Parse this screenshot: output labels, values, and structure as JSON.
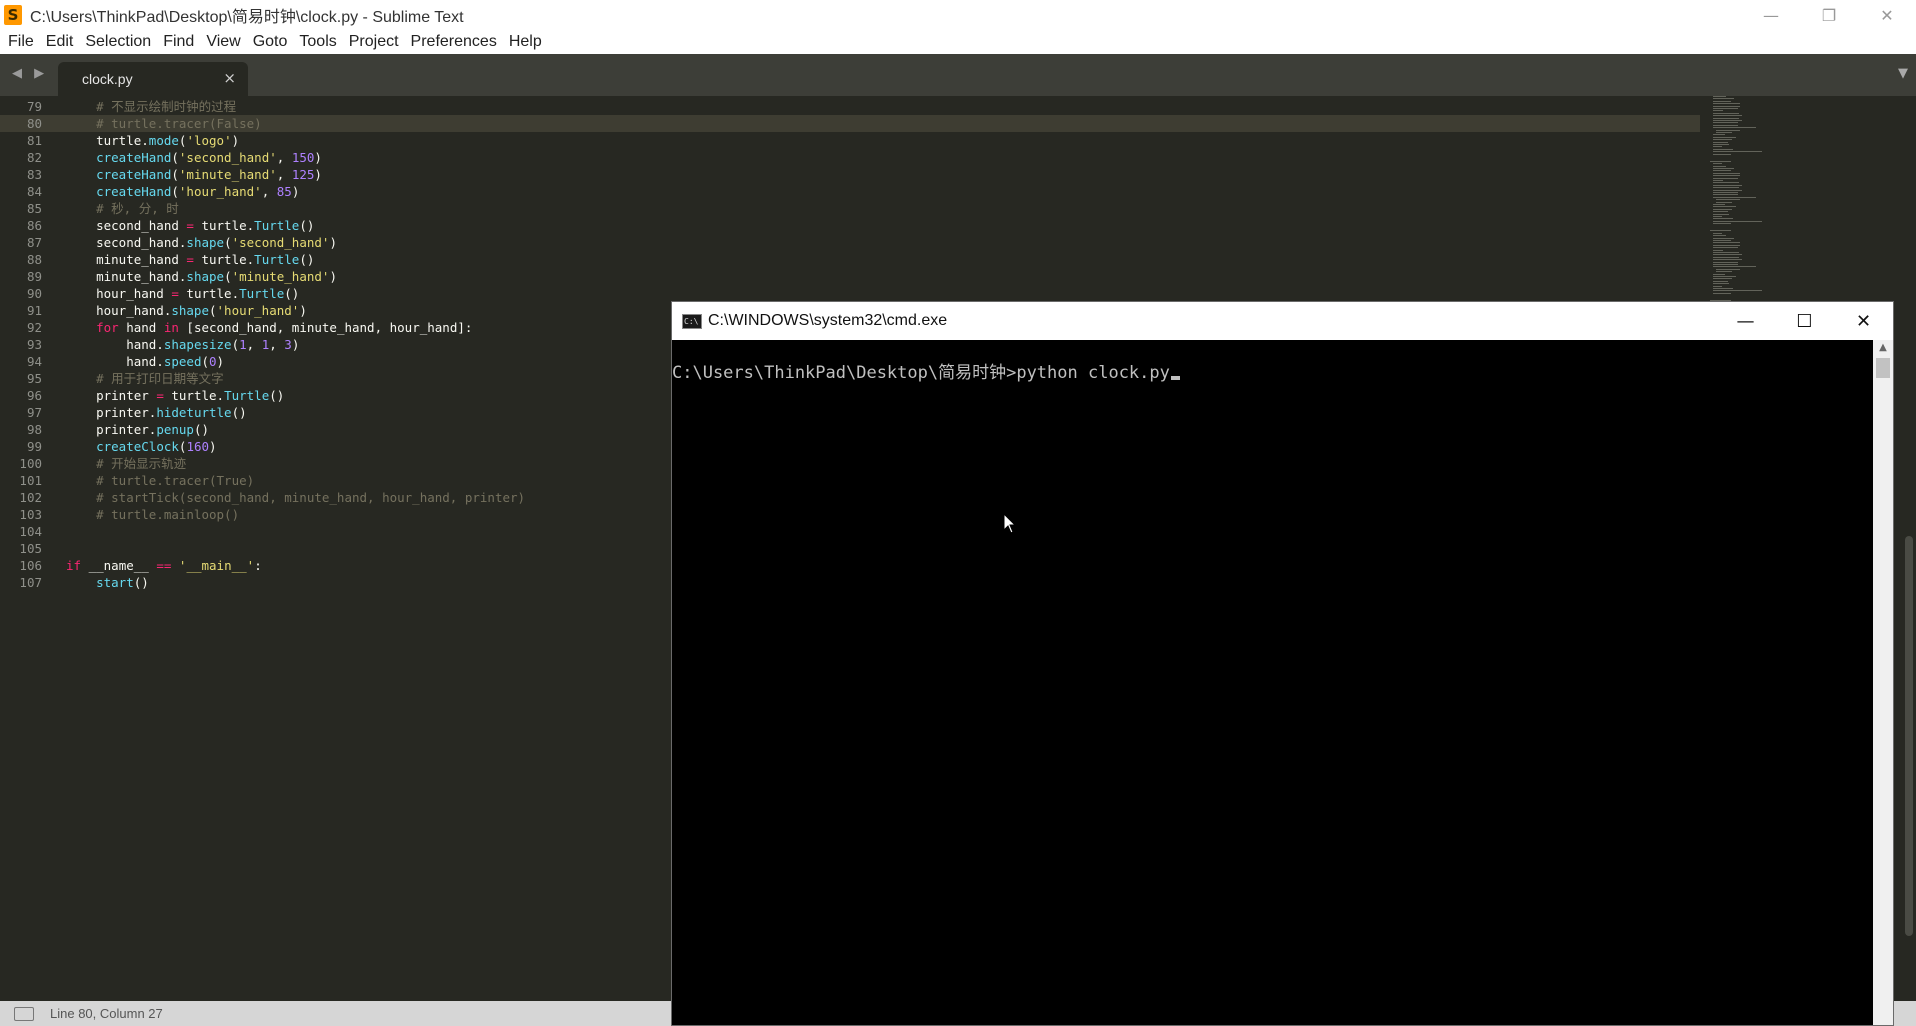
{
  "sublime": {
    "title": "C:\\Users\\ThinkPad\\Desktop\\简易时钟\\clock.py - Sublime Text",
    "app_icon_glyph": "S",
    "controls": {
      "minimize": "—",
      "restore": "❐",
      "close": "✕"
    },
    "menu": [
      "File",
      "Edit",
      "Selection",
      "Find",
      "View",
      "Goto",
      "Tools",
      "Project",
      "Preferences",
      "Help"
    ],
    "nav_arrows": "◀ ▶",
    "tab": {
      "label": "clock.py",
      "close": "×"
    },
    "tab_dropdown": "▼",
    "status": "Line 80, Column 27"
  },
  "editor": {
    "current_line": 80,
    "lines": [
      {
        "n": "79",
        "tokens": [
          [
            "cm",
            "    # 不显示绘制时钟的过程"
          ]
        ]
      },
      {
        "n": "80",
        "tokens": [
          [
            "cm",
            "    # turtle.tracer(False)"
          ]
        ]
      },
      {
        "n": "81",
        "tokens": [
          [
            "",
            "    turtle."
          ],
          [
            "fn",
            "mode"
          ],
          [
            "",
            "("
          ],
          [
            "st",
            "'logo'"
          ],
          [
            "",
            ")"
          ]
        ]
      },
      {
        "n": "82",
        "tokens": [
          [
            "",
            "    "
          ],
          [
            "fn",
            "createHand"
          ],
          [
            "",
            "("
          ],
          [
            "st",
            "'second_hand'"
          ],
          [
            "",
            ", "
          ],
          [
            "nu",
            "150"
          ],
          [
            "",
            ")"
          ]
        ]
      },
      {
        "n": "83",
        "tokens": [
          [
            "",
            "    "
          ],
          [
            "fn",
            "createHand"
          ],
          [
            "",
            "("
          ],
          [
            "st",
            "'minute_hand'"
          ],
          [
            "",
            ", "
          ],
          [
            "nu",
            "125"
          ],
          [
            "",
            ")"
          ]
        ]
      },
      {
        "n": "84",
        "tokens": [
          [
            "",
            "    "
          ],
          [
            "fn",
            "createHand"
          ],
          [
            "",
            "("
          ],
          [
            "st",
            "'hour_hand'"
          ],
          [
            "",
            ", "
          ],
          [
            "nu",
            "85"
          ],
          [
            "",
            ")"
          ]
        ]
      },
      {
        "n": "85",
        "tokens": [
          [
            "cm",
            "    # 秒, 分, 时"
          ]
        ]
      },
      {
        "n": "86",
        "tokens": [
          [
            "",
            "    second_hand "
          ],
          [
            "kw",
            "="
          ],
          [
            "",
            " turtle."
          ],
          [
            "fn",
            "Turtle"
          ],
          [
            "",
            "()"
          ]
        ]
      },
      {
        "n": "87",
        "tokens": [
          [
            "",
            "    second_hand."
          ],
          [
            "fn",
            "shape"
          ],
          [
            "",
            "("
          ],
          [
            "st",
            "'second_hand'"
          ],
          [
            "",
            ")"
          ]
        ]
      },
      {
        "n": "88",
        "tokens": [
          [
            "",
            "    minute_hand "
          ],
          [
            "kw",
            "="
          ],
          [
            "",
            " turtle."
          ],
          [
            "fn",
            "Turtle"
          ],
          [
            "",
            "()"
          ]
        ]
      },
      {
        "n": "89",
        "tokens": [
          [
            "",
            "    minute_hand."
          ],
          [
            "fn",
            "shape"
          ],
          [
            "",
            "("
          ],
          [
            "st",
            "'minute_hand'"
          ],
          [
            "",
            ")"
          ]
        ]
      },
      {
        "n": "90",
        "tokens": [
          [
            "",
            "    hour_hand "
          ],
          [
            "kw",
            "="
          ],
          [
            "",
            " turtle."
          ],
          [
            "fn",
            "Turtle"
          ],
          [
            "",
            "()"
          ]
        ]
      },
      {
        "n": "91",
        "tokens": [
          [
            "",
            "    hour_hand."
          ],
          [
            "fn",
            "shape"
          ],
          [
            "",
            "("
          ],
          [
            "st",
            "'hour_hand'"
          ],
          [
            "",
            ")"
          ]
        ]
      },
      {
        "n": "92",
        "tokens": [
          [
            "",
            "    "
          ],
          [
            "kw",
            "for"
          ],
          [
            "",
            " hand "
          ],
          [
            "kw",
            "in"
          ],
          [
            "",
            " [second_hand, minute_hand, hour_hand]:"
          ]
        ]
      },
      {
        "n": "93",
        "tokens": [
          [
            "",
            "        hand."
          ],
          [
            "fn",
            "shapesize"
          ],
          [
            "",
            "("
          ],
          [
            "nu",
            "1"
          ],
          [
            "",
            ", "
          ],
          [
            "nu",
            "1"
          ],
          [
            "",
            ", "
          ],
          [
            "nu",
            "3"
          ],
          [
            "",
            ")"
          ]
        ]
      },
      {
        "n": "94",
        "tokens": [
          [
            "",
            "        hand."
          ],
          [
            "fn",
            "speed"
          ],
          [
            "",
            "("
          ],
          [
            "nu",
            "0"
          ],
          [
            "",
            ")"
          ]
        ]
      },
      {
        "n": "95",
        "tokens": [
          [
            "cm",
            "    # 用于打印日期等文字"
          ]
        ]
      },
      {
        "n": "96",
        "tokens": [
          [
            "",
            "    printer "
          ],
          [
            "kw",
            "="
          ],
          [
            "",
            " turtle."
          ],
          [
            "fn",
            "Turtle"
          ],
          [
            "",
            "()"
          ]
        ]
      },
      {
        "n": "97",
        "tokens": [
          [
            "",
            "    printer."
          ],
          [
            "fn",
            "hideturtle"
          ],
          [
            "",
            "()"
          ]
        ]
      },
      {
        "n": "98",
        "tokens": [
          [
            "",
            "    printer."
          ],
          [
            "fn",
            "penup"
          ],
          [
            "",
            "()"
          ]
        ]
      },
      {
        "n": "99",
        "tokens": [
          [
            "",
            "    "
          ],
          [
            "fn",
            "createClock"
          ],
          [
            "",
            "("
          ],
          [
            "nu",
            "160"
          ],
          [
            "",
            ")"
          ]
        ]
      },
      {
        "n": "100",
        "tokens": [
          [
            "cm",
            "    # 开始显示轨迹"
          ]
        ]
      },
      {
        "n": "101",
        "tokens": [
          [
            "cm",
            "    # turtle.tracer(True)"
          ]
        ]
      },
      {
        "n": "102",
        "tokens": [
          [
            "cm",
            "    # startTick(second_hand, minute_hand, hour_hand, printer)"
          ]
        ]
      },
      {
        "n": "103",
        "tokens": [
          [
            "cm",
            "    # turtle.mainloop()"
          ]
        ]
      },
      {
        "n": "104",
        "tokens": []
      },
      {
        "n": "105",
        "tokens": []
      },
      {
        "n": "106",
        "tokens": [
          [
            "kw",
            "if"
          ],
          [
            "",
            " __name__ "
          ],
          [
            "kw",
            "=="
          ],
          [
            "",
            " "
          ],
          [
            "st",
            "'__main__'"
          ],
          [
            "",
            ":"
          ]
        ]
      },
      {
        "n": "107",
        "tokens": [
          [
            "",
            "    "
          ],
          [
            "fn",
            "start"
          ],
          [
            "",
            "()"
          ]
        ]
      }
    ]
  },
  "cmd": {
    "title": "C:\\WINDOWS\\system32\\cmd.exe",
    "icon_glyph": "C:\\",
    "controls": {
      "minimize": "—",
      "maximize": "☐",
      "close": "✕"
    },
    "prompt": "C:\\Users\\ThinkPad\\Desktop\\简易时钟>python clock.py",
    "scroll_up": "▲"
  }
}
